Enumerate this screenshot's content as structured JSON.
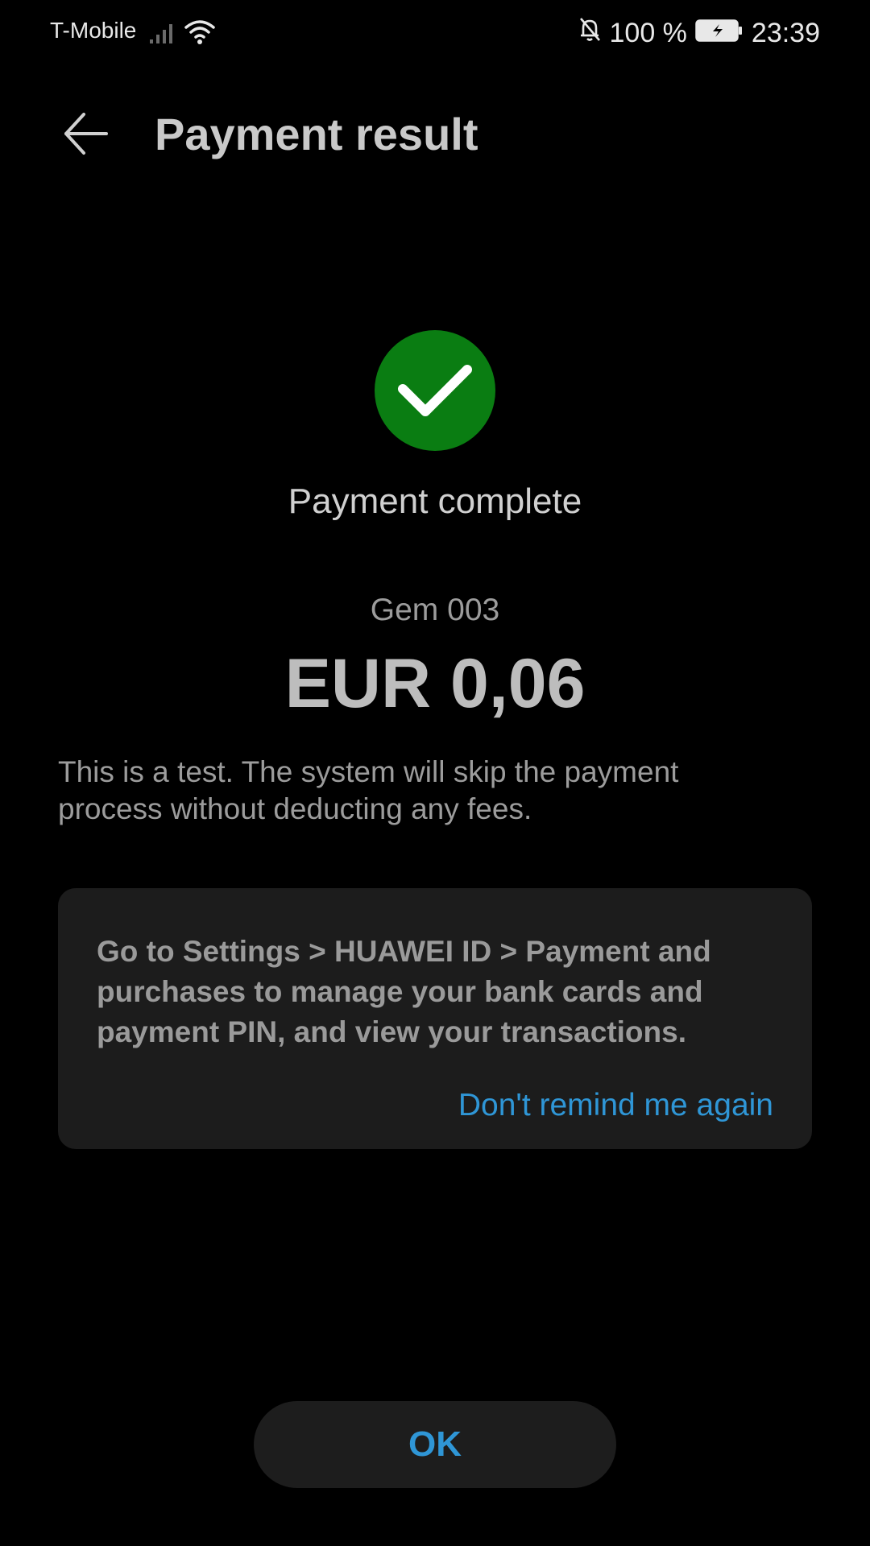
{
  "status_bar": {
    "carrier": "T-Mobile",
    "battery_percent": "100 %",
    "time": "23:39",
    "icons": [
      "signal-icon",
      "wifi-icon",
      "bell-off-icon",
      "battery-charging-icon"
    ]
  },
  "header": {
    "title": "Payment result",
    "back_icon": "arrow-left-icon"
  },
  "result": {
    "status_icon": "checkmark-icon",
    "status_color": "#0a7d12",
    "status_text": "Payment complete",
    "product": "Gem 003",
    "amount": "EUR 0,06",
    "notice": "This is a test. The system will skip the payment process without deducting any fees."
  },
  "tip_card": {
    "text": "Go to Settings > HUAWEI ID > Payment and purchases to manage your bank cards and payment PIN, and view your transactions.",
    "action_label": "Don't remind me again"
  },
  "footer": {
    "ok_label": "OK"
  },
  "colors": {
    "accent": "#2f96d6",
    "background": "#000000",
    "card": "#1c1c1c"
  }
}
